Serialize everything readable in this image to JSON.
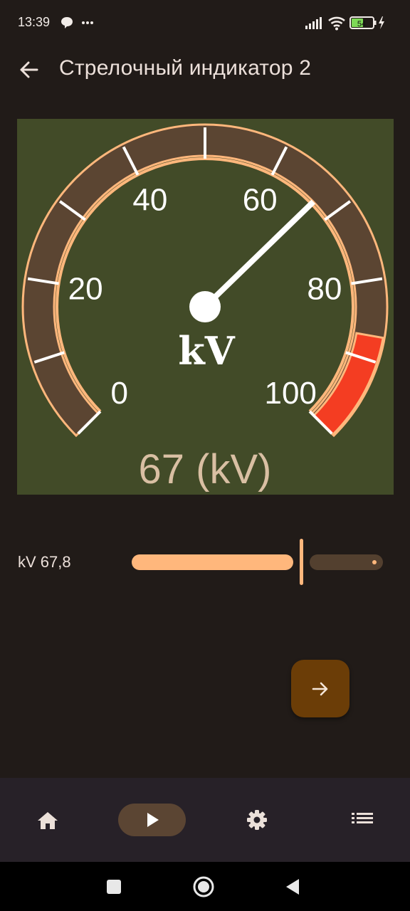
{
  "status_bar": {
    "time": "13:39",
    "left_icons": [
      "chat-bubble-icon",
      "more-dots-icon"
    ],
    "right_icons": [
      "signal-icon",
      "wifi-icon",
      "battery-icon",
      "charging-bolt-icon"
    ],
    "battery_level": "54"
  },
  "app_bar": {
    "back_icon": "arrow-left-icon",
    "title": "Стрелочный индикатор 2"
  },
  "gauge": {
    "min": 0,
    "max": 100,
    "value": 67,
    "tick_labels": [
      "0",
      "20",
      "40",
      "60",
      "80",
      "100"
    ],
    "unit_label": "kV",
    "readout": "67 (kV)",
    "red_zone_start": 87,
    "colors": {
      "panel": "#424b28",
      "arc": "#5b4532",
      "arc_outline": "#ffb77c",
      "red_zone": "#f43d22",
      "needle": "#ffffff",
      "readout": "#d9bfa3"
    }
  },
  "slider": {
    "label": "kV 67,8",
    "value": 67.8,
    "min": 0,
    "max": 100
  },
  "fab": {
    "icon": "arrow-right-icon"
  },
  "bottom_nav": {
    "items": [
      {
        "icon": "home-icon",
        "selected": false
      },
      {
        "icon": "play-icon",
        "selected": true
      },
      {
        "icon": "gear-icon",
        "selected": false
      },
      {
        "icon": "list-icon",
        "selected": false
      }
    ]
  },
  "system_nav": [
    "recents-square-icon",
    "home-circle-icon",
    "back-triangle-icon"
  ],
  "colors": {
    "background": "#211b18",
    "accent": "#ffb77c",
    "fab": "#6b3d07",
    "nav_bar": "#272128",
    "nav_selected": "#5b4533"
  }
}
